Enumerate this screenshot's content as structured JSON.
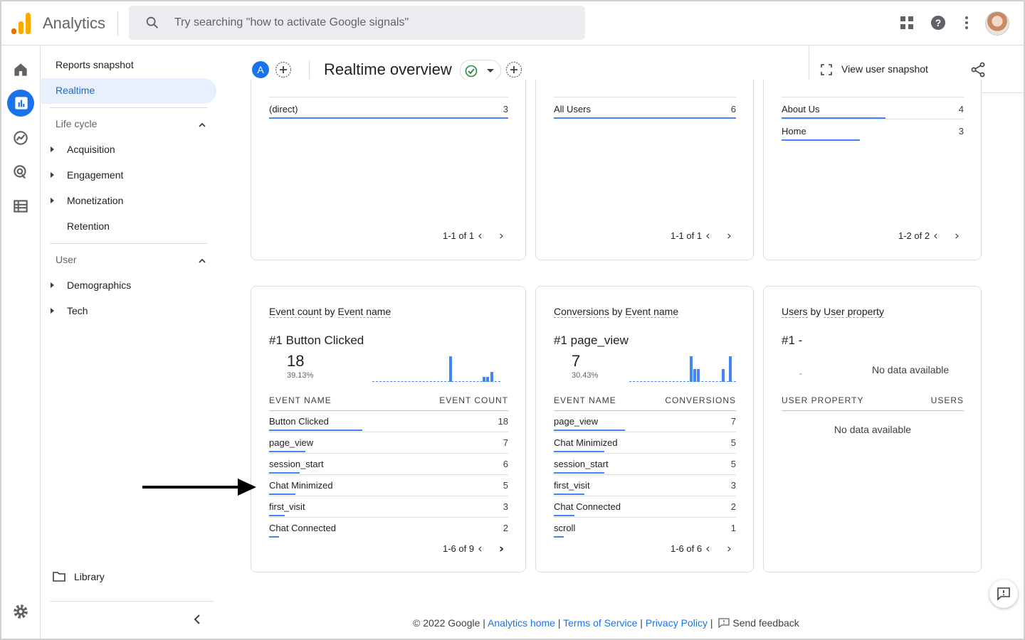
{
  "app": {
    "title": "Analytics",
    "brand_colors": [
      "#f9ab00",
      "#e37400"
    ]
  },
  "search": {
    "placeholder": "Try searching \"how to activate Google signals\""
  },
  "topbar": {
    "icons": [
      "apps-grid-icon",
      "help-icon",
      "more-vert-icon",
      "avatar"
    ]
  },
  "rail": {
    "icons": [
      "home-icon",
      "reports-icon",
      "explore-icon",
      "advertising-icon",
      "configure-icon",
      "settings-icon"
    ]
  },
  "nav": {
    "reports_snapshot": "Reports snapshot",
    "realtime": "Realtime",
    "lifecycle": "Life cycle",
    "lifecycle_items": [
      "Acquisition",
      "Engagement",
      "Monetization",
      "Retention"
    ],
    "user": "User",
    "user_items": [
      "Demographics",
      "Tech"
    ],
    "library": "Library"
  },
  "header": {
    "comparison_badge": "A",
    "title": "Realtime overview",
    "view_user_snapshot": "View user snapshot"
  },
  "top_cards": [
    {
      "rows": [
        {
          "label": "(direct)",
          "value": "3",
          "fill": 1.0
        }
      ],
      "pager": "1-1 of 1"
    },
    {
      "rows": [
        {
          "label": "All Users",
          "value": "6",
          "fill": 1.0
        }
      ],
      "pager": "1-1 of 1"
    },
    {
      "rows": [
        {
          "label": "About Us",
          "value": "4",
          "fill": 1.0
        },
        {
          "label": "Home",
          "value": "3",
          "fill": 0.75
        }
      ],
      "pager": "1-2 of 2"
    }
  ],
  "event_card": {
    "title_metric": "Event count",
    "title_by": " by ",
    "title_dim": "Event name",
    "top_label": "#1  Button Clicked",
    "top_value": "18",
    "top_pct": "39.13%",
    "col1": "EVENT NAME",
    "col2": "EVENT COUNT",
    "rows": [
      {
        "label": "Button Clicked",
        "value": "18",
        "fill": 1.0
      },
      {
        "label": "page_view",
        "value": "7",
        "fill": 0.39
      },
      {
        "label": "session_start",
        "value": "6",
        "fill": 0.33
      },
      {
        "label": "Chat Minimized",
        "value": "5",
        "fill": 0.28
      },
      {
        "label": "first_visit",
        "value": "3",
        "fill": 0.17
      },
      {
        "label": "Chat Connected",
        "value": "2",
        "fill": 0.11
      }
    ],
    "pager": "1-6 of 9"
  },
  "conversion_card": {
    "title_metric": "Conversions",
    "title_by": " by ",
    "title_dim": "Event name",
    "top_label": "#1  page_view",
    "top_value": "7",
    "top_pct": "30.43%",
    "col1": "EVENT NAME",
    "col2": "CONVERSIONS",
    "rows": [
      {
        "label": "page_view",
        "value": "7",
        "fill": 1.0
      },
      {
        "label": "Chat Minimized",
        "value": "5",
        "fill": 0.71
      },
      {
        "label": "session_start",
        "value": "5",
        "fill": 0.71
      },
      {
        "label": "first_visit",
        "value": "3",
        "fill": 0.43
      },
      {
        "label": "Chat Connected",
        "value": "2",
        "fill": 0.29
      },
      {
        "label": "scroll",
        "value": "1",
        "fill": 0.14
      }
    ],
    "pager": "1-6 of 6"
  },
  "property_card": {
    "title_metric": "Users",
    "title_by": " by ",
    "title_dim": "User property",
    "top_label": "#1  -",
    "dash": "-",
    "no_data_chart": "No data available",
    "col1": "USER PROPERTY",
    "col2": "USERS",
    "no_data_table": "No data available"
  },
  "footer": {
    "copyright": "© 2022 Google | ",
    "analytics_home": "Analytics home",
    "sep": " | ",
    "terms": "Terms of Service",
    "privacy": "Privacy Policy",
    "sep_end": " | ",
    "feedback": "Send feedback"
  }
}
